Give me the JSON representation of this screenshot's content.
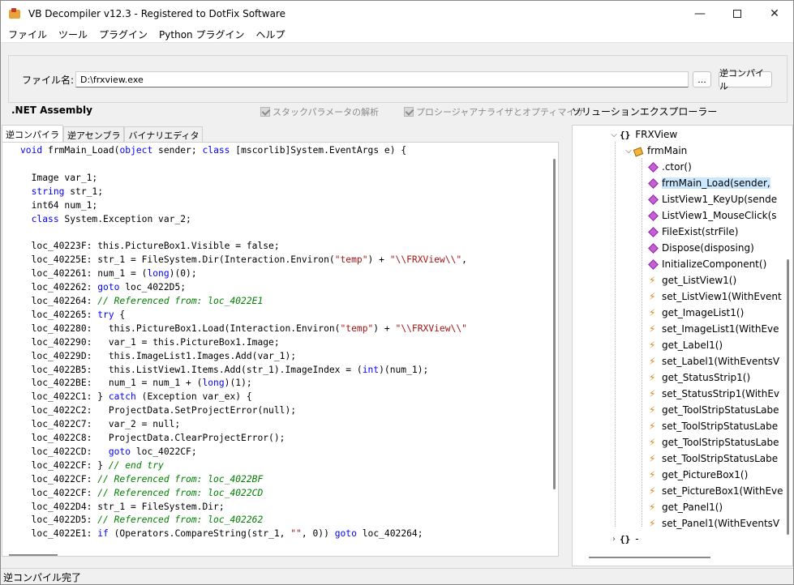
{
  "window": {
    "title": "VB Decompiler v12.3 - Registered to DotFix Software",
    "min_icon": "minimize-icon",
    "max_icon": "maximize-icon",
    "close_icon": "close-icon"
  },
  "menu": [
    "ファイル",
    "ツール",
    "プラグイン",
    "Python プラグイン",
    "ヘルプ"
  ],
  "file": {
    "label": "ファイル名:",
    "value": "D:\\frxview.exe",
    "browse_label": "...",
    "decompile_label": "逆コンパイル"
  },
  "options": {
    "net_assembly": ".NET Assembly",
    "stack_params": "スタックパラメータの解析",
    "procedure_analyzer": "プロシージャアナライザとオプティマイザ",
    "solution_explorer": "ソリューションエクスプローラー"
  },
  "tabs": [
    "逆コンパイラ",
    "逆アセンブラ",
    "バイナリエディタ"
  ],
  "code_lines": [
    "void frmMain_Load(object sender; class [mscorlib]System.EventArgs e) {",
    "",
    "  Image var_1;",
    "  string str_1;",
    "  int64 num_1;",
    "  class System.Exception var_2;",
    "",
    "  loc_40223F: this.PictureBox1.Visible = false;",
    "  loc_40225E: str_1 = FileSystem.Dir(Interaction.Environ(\"temp\") + \"\\\\FRXView\\\\\",",
    "  loc_402261: num_1 = (long)(0);",
    "  loc_402262: goto loc_4022D5;",
    "  loc_402264: // Referenced from: loc_4022E1",
    "  loc_402265: try {",
    "  loc_402280:   this.PictureBox1.Load(Interaction.Environ(\"temp\") + \"\\\\FRXView\\\\\"",
    "  loc_402290:   var_1 = this.PictureBox1.Image;",
    "  loc_40229D:   this.ImageList1.Images.Add(var_1);",
    "  loc_4022B5:   this.ListView1.Items.Add(str_1).ImageIndex = (int)(num_1);",
    "  loc_4022BE:   num_1 = num_1 + (long)(1);",
    "  loc_4022C1: } catch (Exception var_ex) {",
    "  loc_4022C2:   ProjectData.SetProjectError(null);",
    "  loc_4022C7:   var_2 = null;",
    "  loc_4022C8:   ProjectData.ClearProjectError();",
    "  loc_4022CD:   goto loc_4022CF;",
    "  loc_4022CF: } // end try",
    "  loc_4022CF: // Referenced from: loc_4022BF",
    "  loc_4022CF: // Referenced from: loc_4022CD",
    "  loc_4022D4: str_1 = FileSystem.Dir;",
    "  loc_4022D5: // Referenced from: loc_402262",
    "  loc_4022E1: if (Operators.CompareString(str_1, \"\", 0)) goto loc_402264;"
  ],
  "tree": [
    {
      "label": "FRXView",
      "kind": "namespace",
      "indent": 0,
      "chev": "⌵"
    },
    {
      "label": "frmMain",
      "kind": "class",
      "indent": 1,
      "chev": "⌵"
    },
    {
      "label": ".ctor()",
      "kind": "method",
      "indent": 2
    },
    {
      "label": "frmMain_Load(sender,",
      "kind": "method",
      "indent": 2,
      "selected": true
    },
    {
      "label": "ListView1_KeyUp(sende",
      "kind": "method",
      "indent": 2
    },
    {
      "label": "ListView1_MouseClick(s",
      "kind": "method",
      "indent": 2
    },
    {
      "label": "FileExist(strFile)",
      "kind": "method",
      "indent": 2
    },
    {
      "label": "Dispose(disposing)",
      "kind": "method",
      "indent": 2
    },
    {
      "label": "InitializeComponent()",
      "kind": "method",
      "indent": 2
    },
    {
      "label": "get_ListView1()",
      "kind": "prop",
      "indent": 2
    },
    {
      "label": "set_ListView1(WithEvent",
      "kind": "prop",
      "indent": 2
    },
    {
      "label": "get_ImageList1()",
      "kind": "prop",
      "indent": 2
    },
    {
      "label": "set_ImageList1(WithEve",
      "kind": "prop",
      "indent": 2
    },
    {
      "label": "get_Label1()",
      "kind": "prop",
      "indent": 2
    },
    {
      "label": "set_Label1(WithEventsV",
      "kind": "prop",
      "indent": 2
    },
    {
      "label": "get_StatusStrip1()",
      "kind": "prop",
      "indent": 2
    },
    {
      "label": "set_StatusStrip1(WithEv",
      "kind": "prop",
      "indent": 2
    },
    {
      "label": "get_ToolStripStatusLabe",
      "kind": "prop",
      "indent": 2
    },
    {
      "label": "set_ToolStripStatusLabe",
      "kind": "prop",
      "indent": 2
    },
    {
      "label": "get_ToolStripStatusLabe",
      "kind": "prop",
      "indent": 2
    },
    {
      "label": "set_ToolStripStatusLabe",
      "kind": "prop",
      "indent": 2
    },
    {
      "label": "get_PictureBox1()",
      "kind": "prop",
      "indent": 2
    },
    {
      "label": "set_PictureBox1(WithEve",
      "kind": "prop",
      "indent": 2
    },
    {
      "label": "get_Panel1()",
      "kind": "prop",
      "indent": 2
    },
    {
      "label": "set_Panel1(WithEventsV",
      "kind": "prop",
      "indent": 2
    },
    {
      "label": "-",
      "kind": "namespace",
      "indent": 0,
      "chev": "›"
    }
  ],
  "status": "逆コンパイル完了"
}
